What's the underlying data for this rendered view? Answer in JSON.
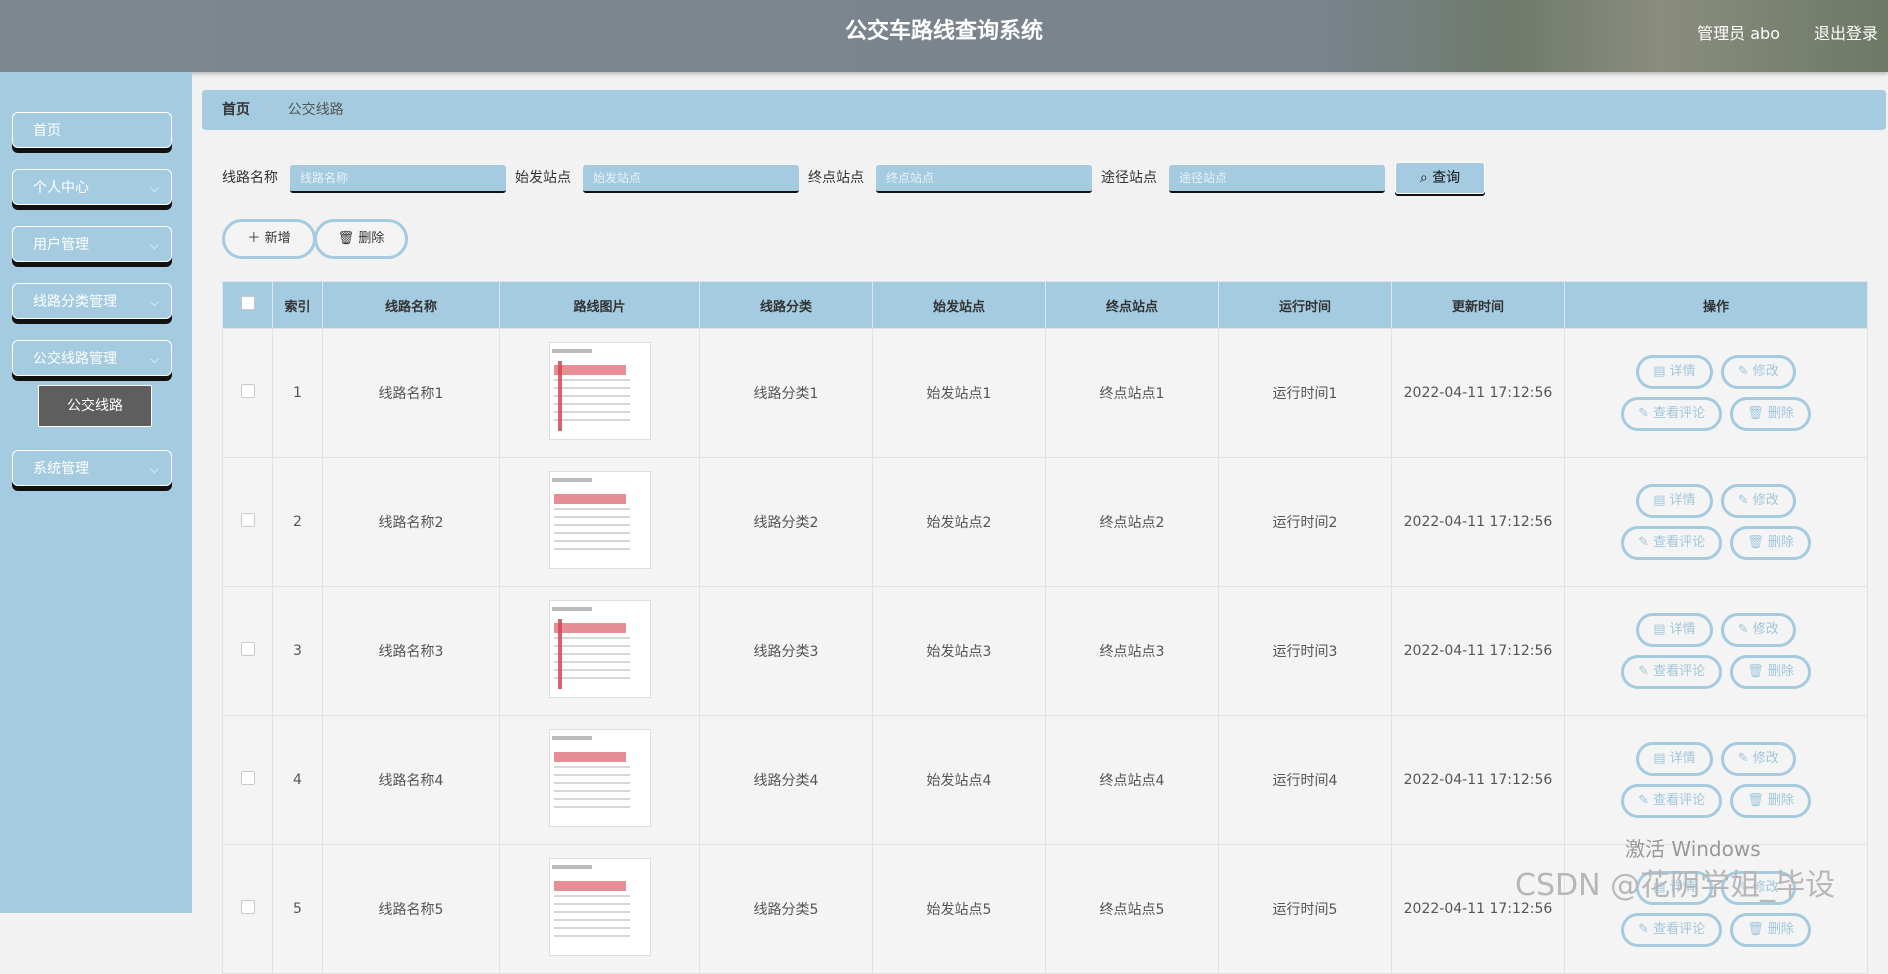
{
  "header": {
    "title": "公交车路线查询系统",
    "user": "管理员 abo",
    "logout": "退出登录"
  },
  "sidebar": {
    "items": [
      {
        "label": "首页"
      },
      {
        "label": "个人中心"
      },
      {
        "label": "用户管理"
      },
      {
        "label": "线路分类管理"
      },
      {
        "label": "公交线路管理"
      },
      {
        "label": "系统管理"
      }
    ],
    "sub_item": "公交线路"
  },
  "breadcrumb": {
    "home": "首页",
    "separator": "/",
    "current": "公交线路"
  },
  "search": {
    "fields": [
      {
        "label": "线路名称",
        "placeholder": "线路名称"
      },
      {
        "label": "始发站点",
        "placeholder": "始发站点"
      },
      {
        "label": "终点站点",
        "placeholder": "终点站点"
      },
      {
        "label": "途径站点",
        "placeholder": "途径站点"
      }
    ],
    "button": "查询"
  },
  "actions": {
    "add": "新增",
    "delete": "删除"
  },
  "table": {
    "headers": [
      "索引",
      "线路名称",
      "路线图片",
      "线路分类",
      "始发站点",
      "终点站点",
      "运行时间",
      "更新时间",
      "操作"
    ],
    "rows": [
      {
        "index": "1",
        "name": "线路名称1",
        "category": "线路分类1",
        "start": "始发站点1",
        "end": "终点站点1",
        "runtime": "运行时间1",
        "updated": "2022-04-11 17:12:56"
      },
      {
        "index": "2",
        "name": "线路名称2",
        "category": "线路分类2",
        "start": "始发站点2",
        "end": "终点站点2",
        "runtime": "运行时间2",
        "updated": "2022-04-11 17:12:56"
      },
      {
        "index": "3",
        "name": "线路名称3",
        "category": "线路分类3",
        "start": "始发站点3",
        "end": "终点站点3",
        "runtime": "运行时间3",
        "updated": "2022-04-11 17:12:56"
      },
      {
        "index": "4",
        "name": "线路名称4",
        "category": "线路分类4",
        "start": "始发站点4",
        "end": "终点站点4",
        "runtime": "运行时间4",
        "updated": "2022-04-11 17:12:56"
      },
      {
        "index": "5",
        "name": "线路名称5",
        "category": "线路分类5",
        "start": "始发站点5",
        "end": "终点站点5",
        "runtime": "运行时间5",
        "updated": "2022-04-11 17:12:56"
      }
    ],
    "ops": {
      "detail": "详情",
      "edit": "修改",
      "comments": "查看评论",
      "delete": "删除"
    }
  },
  "watermark": {
    "windows": "激活 Windows",
    "csdn": "CSDN @花阴学姐_毕设"
  }
}
